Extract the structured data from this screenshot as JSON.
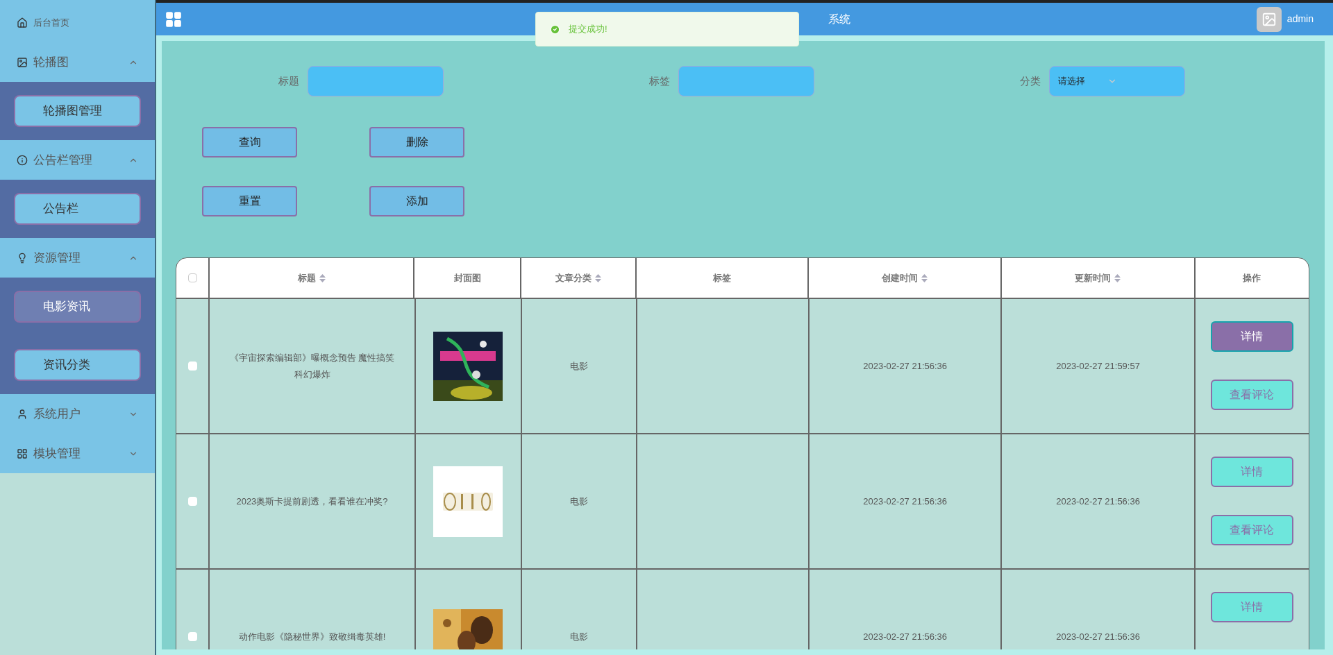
{
  "header": {
    "title": "系统",
    "user": "admin"
  },
  "toast": {
    "message": "提交成功!"
  },
  "sidebar": {
    "items": [
      {
        "label": "后台首页"
      },
      {
        "label": "轮播图",
        "expanded": true,
        "children": [
          {
            "label": "轮播图管理",
            "selected": false
          }
        ]
      },
      {
        "label": "公告栏管理",
        "expanded": true,
        "children": [
          {
            "label": "公告栏",
            "selected": false
          }
        ]
      },
      {
        "label": "资源管理",
        "expanded": true,
        "children": [
          {
            "label": "电影资讯",
            "selected": true
          },
          {
            "label": "资讯分类",
            "selected": false
          }
        ]
      },
      {
        "label": "系统用户",
        "expanded": false
      },
      {
        "label": "模块管理",
        "expanded": false
      }
    ]
  },
  "filters": [
    {
      "label": "标题",
      "kind": "input"
    },
    {
      "label": "标签",
      "kind": "input"
    },
    {
      "label": "分类",
      "kind": "select",
      "placeholder": "请选择"
    }
  ],
  "actions": [
    "查询",
    "删除",
    "重置",
    "添加"
  ],
  "table": {
    "all_checked": false,
    "columns": [
      {
        "label": "标题",
        "sortable": true
      },
      {
        "label": "封面图",
        "sortable": false
      },
      {
        "label": "文章分类",
        "sortable": true
      },
      {
        "label": "标签",
        "sortable": false
      },
      {
        "label": "创建时间",
        "sortable": true
      },
      {
        "label": "更新时间",
        "sortable": true
      },
      {
        "label": "操作",
        "sortable": false
      }
    ],
    "rows": [
      {
        "checked": false,
        "title": "《宇宙探索编辑部》曝概念预告 魔性搞笑科幻爆炸",
        "category": "电影",
        "created": "2023-02-27 21:56:36",
        "updated": "2023-02-27 21:59:57",
        "buttons": [
          {
            "label": "详情",
            "highlighted": true
          },
          {
            "label": "查看评论",
            "highlighted": false
          }
        ]
      },
      {
        "checked": false,
        "title": "2023奥斯卡提前剧透，看看谁在冲奖?",
        "category": "电影",
        "created": "2023-02-27 21:56:36",
        "updated": "2023-02-27 21:56:36",
        "buttons": [
          {
            "label": "详情",
            "highlighted": false
          },
          {
            "label": "查看评论",
            "highlighted": false
          }
        ]
      },
      {
        "checked": false,
        "title": "动作电影《隐秘世界》致敬缉毒英雄!",
        "category": "电影",
        "created": "2023-02-27 21:56:36",
        "updated": "2023-02-27 21:56:36",
        "buttons": [
          {
            "label": "详情",
            "highlighted": false
          }
        ]
      }
    ]
  }
}
